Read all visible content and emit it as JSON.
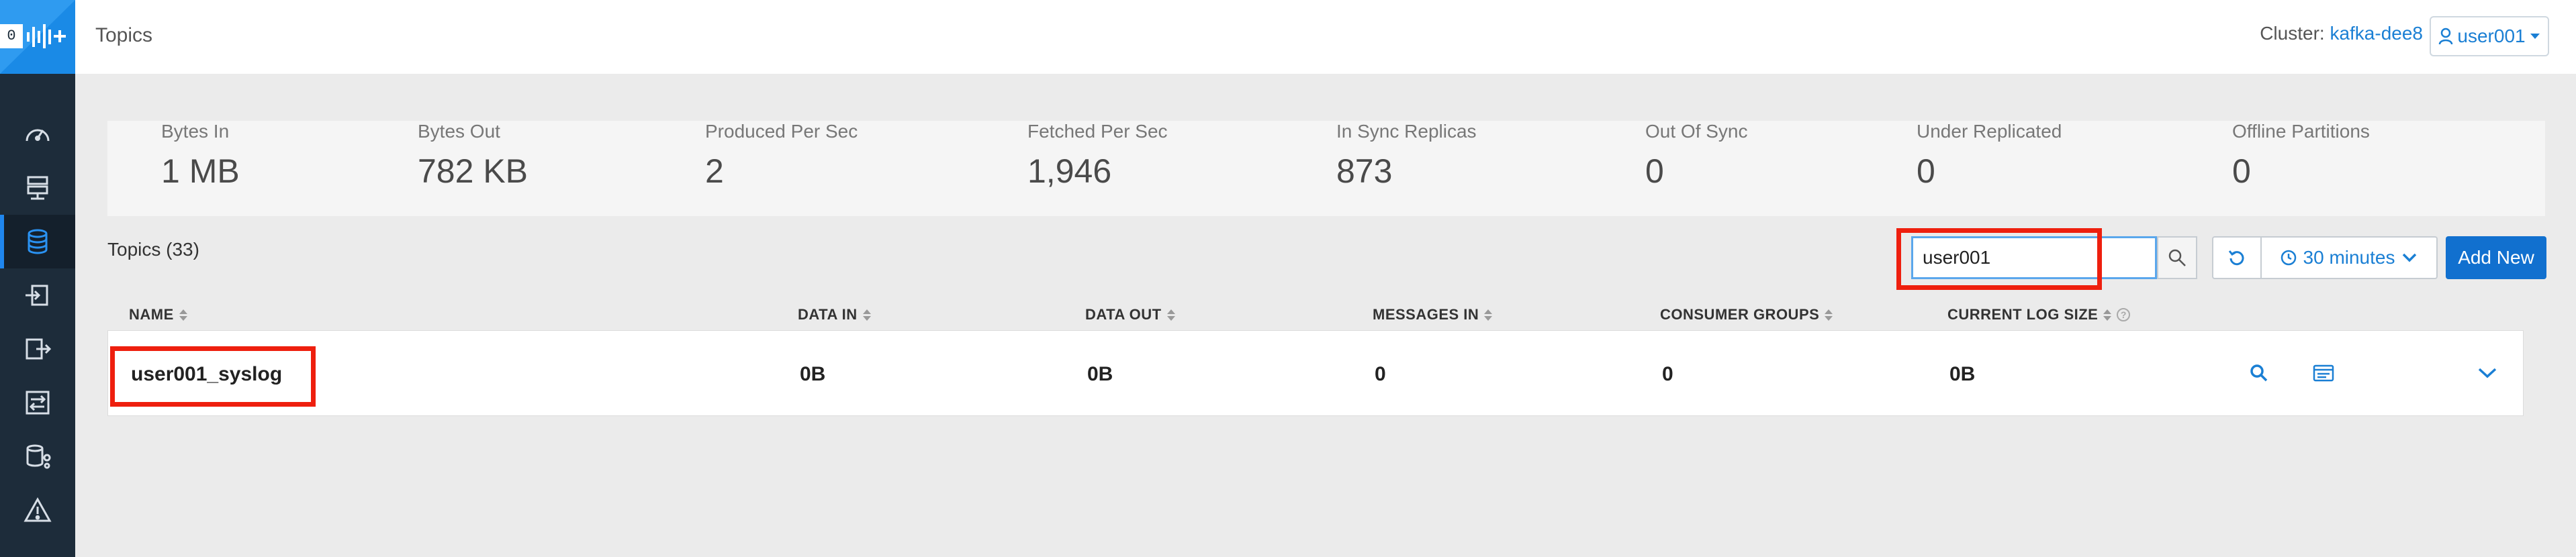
{
  "sidebar": {
    "logo_badge": "0",
    "items": [
      {
        "icon": "gauge-icon"
      },
      {
        "icon": "brokers-icon"
      },
      {
        "icon": "database-icon",
        "active": true
      },
      {
        "icon": "producers-icon"
      },
      {
        "icon": "consumers-icon"
      },
      {
        "icon": "replication-icon"
      },
      {
        "icon": "lineage-icon"
      },
      {
        "icon": "alert-icon"
      }
    ]
  },
  "header": {
    "title": "Topics",
    "cluster_label": "Cluster:",
    "cluster_name": "kafka-dee8",
    "user": "user001"
  },
  "stats": [
    {
      "label": "Bytes In",
      "value": "1 MB"
    },
    {
      "label": "Bytes Out",
      "value": "782 KB"
    },
    {
      "label": "Produced Per Sec",
      "value": "2"
    },
    {
      "label": "Fetched Per Sec",
      "value": "1,946"
    },
    {
      "label": "In Sync Replicas",
      "value": "873"
    },
    {
      "label": "Out Of Sync",
      "value": "0"
    },
    {
      "label": "Under Replicated",
      "value": "0"
    },
    {
      "label": "Offline Partitions",
      "value": "0"
    }
  ],
  "toolbar": {
    "topics_count": "Topics (33)",
    "search_value": "user001",
    "time_range": "30 minutes",
    "add_label": "Add New"
  },
  "table": {
    "columns": [
      "NAME",
      "DATA IN",
      "DATA OUT",
      "MESSAGES IN",
      "CONSUMER GROUPS",
      "CURRENT LOG SIZE"
    ],
    "rows": [
      {
        "name": "user001_syslog",
        "data_in": "0B",
        "data_out": "0B",
        "messages_in": "0",
        "consumer_groups": "0",
        "log_size": "0B"
      }
    ]
  },
  "colors": {
    "sidebar": "#1d2c3a",
    "accent": "#1a7fd4",
    "primary_button": "#1170cf",
    "highlight": "#ee1f0e"
  }
}
